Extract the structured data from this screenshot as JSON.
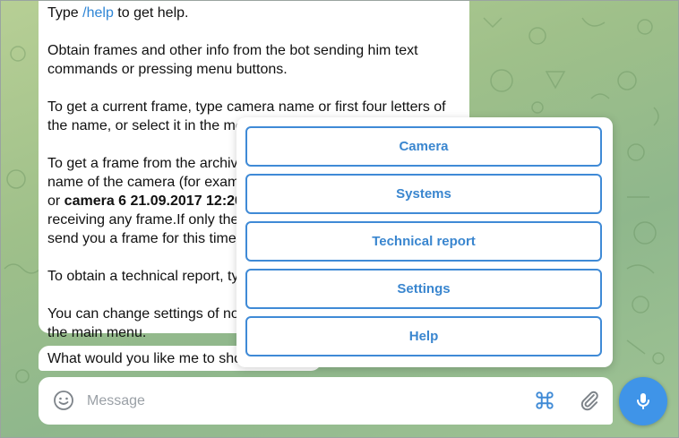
{
  "chat": {
    "message": {
      "help_prefix": "Type ",
      "help_command": "/help",
      "help_suffix": " to get help.",
      "para2": "Obtain frames and other info from the bot sending him text commands or pressing menu buttons.",
      "para3": "To get a current frame, type camera name or first four letters of the name, or select it in the me",
      "para4_line1": "To get a frame from the archiv",
      "para4_line2": "name of the camera (for exam",
      "para4_line3_prefix": "or ",
      "para4_line3_bold": "camera 6 21.09.2017 12:20",
      "para4_line4": "receiving any frame.If only the",
      "para4_line5": "send you a frame for this time",
      "para5": "To obtain a technical report, ty",
      "para6_line1": "You can change settings of no",
      "para6_line2": "the main menu."
    },
    "question": "What would you like me to sho"
  },
  "keyboard_menu": {
    "buttons": [
      {
        "label": "Camera"
      },
      {
        "label": "Systems"
      },
      {
        "label": "Technical report"
      },
      {
        "label": "Settings"
      },
      {
        "label": "Help"
      }
    ]
  },
  "composer": {
    "placeholder": "Message",
    "icons": {
      "emoji": "emoji-icon",
      "commands": "command-icon",
      "attach": "paperclip-icon",
      "mic": "microphone-icon"
    }
  },
  "colors": {
    "accent": "#3f94e8",
    "button_border": "#3f8ad6",
    "button_text": "#3a86cf",
    "link": "#2f86d6"
  }
}
